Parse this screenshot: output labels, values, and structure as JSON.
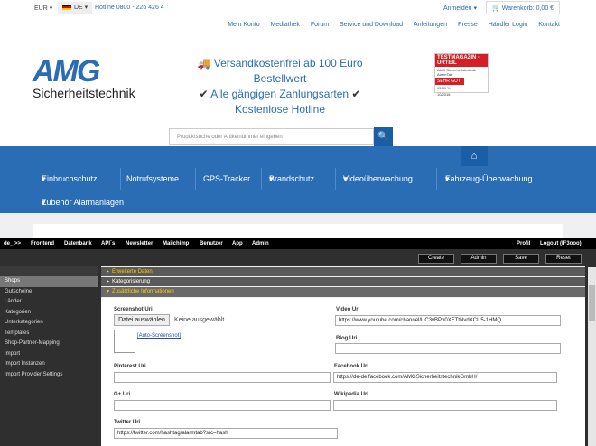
{
  "topbar": {
    "currency": "EUR",
    "language": "DE",
    "hotline": "Hotline 0800 - 226 426 4",
    "login": "Anmelden",
    "cart": "Warenkorb: 0,00 €"
  },
  "secondary_nav": [
    "Mein Konto",
    "Mediathek",
    "Forum",
    "Service und Download",
    "Anleitungen",
    "Presse",
    "Händler Login",
    "Kontakt"
  ],
  "logo": {
    "brand": "AMG",
    "subtitle": "Sicherheitstechnik"
  },
  "usp": {
    "line1": "Versandkostenfrei ab 100 Euro",
    "line2": "Bestellwert",
    "line3": "Alle gängigen Zahlungsarten",
    "line4": "Kostenlose Hotline"
  },
  "badge": {
    "title": "TESTMAGAZIN · URTEIL",
    "product": "AMG Sicherheitstechnik AlarmTab",
    "rating": "SEHR GUT",
    "score": "95,39 %",
    "date": "10/2016"
  },
  "search": {
    "placeholder": "Produktsuche oder Artikelnummer eingeben"
  },
  "main_nav": [
    "Einbruchschutz",
    "Notrufsysteme",
    "GPS-Tracker",
    "Brandschutz",
    "Videoüberwachung",
    "Fahrzeug-Überwachung",
    "Zubehör Alarmanlagen"
  ],
  "admin": {
    "menu": [
      "de_ >>",
      "Frontend",
      "Datenbank",
      "API´s",
      "Newsletter",
      "Mailchimp",
      "Benutzer",
      "App",
      "Admin",
      "Profil",
      "Logout (IF3ooo)"
    ],
    "buttons": [
      "Create",
      "Admin",
      "Save",
      "Reset"
    ],
    "sidebar": [
      "Shops",
      "Gutscheine",
      "Länder",
      "Kategorien",
      "Unterkategorien",
      "Templates",
      "Shop-Partner-Mapping",
      "Import",
      "Import Instanzen",
      "Import Provider Settings"
    ],
    "sections": [
      "Erweiterte Daten",
      "Kategorisierung",
      "Zusätzliche Informationen"
    ],
    "form": {
      "screenshot_label": "Screenshot Uri",
      "file_button": "Datei auswählen",
      "file_none": "Keine ausgewählt",
      "auto_screenshot": "[Auto-Screenshot]",
      "video_label": "Video Uri",
      "video_value": "https://www.youtube.com/channel/UC3vBPp0XETtNvdXCU5-1HMQ",
      "blog_label": "Blog Uri",
      "pinterest_label": "Pinterest Uri",
      "facebook_label": "Facebook Uri",
      "facebook_value": "https://de-de.facebook.com/AMGSicherheitstechnikGmbH/",
      "gplus_label": "G+ Uri",
      "wikipedia_label": "Wikipedia Uri",
      "twitter_label": "Twitter Uri",
      "twitter_value": "https://twitter.com/hashtag/alarmtab?src=hash"
    }
  },
  "colors": {
    "brand_blue": "#2a6db5",
    "admin_dark": "#2f2f2f",
    "accent_yellow": "#ffcc00"
  }
}
